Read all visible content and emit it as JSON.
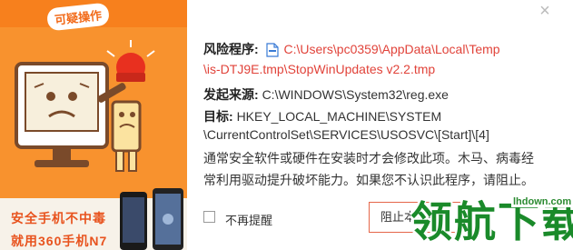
{
  "ad": {
    "badge": "可疑操作",
    "line1": "安全手机不中毒",
    "line2": "就用360手机N7"
  },
  "dialog": {
    "close_label": "×",
    "risk_label": "风险程序:",
    "risk_path_line1": "C:\\Users\\pc0359\\AppData\\Local\\Temp",
    "risk_path_line2": "\\is-DTJ9E.tmp\\StopWinUpdates v2.2.tmp",
    "source_label": "发起来源:",
    "source_value": "C:\\WINDOWS\\System32\\reg.exe",
    "target_label": "目标:",
    "target_line1": "HKEY_LOCAL_MACHINE\\SYSTEM",
    "target_line2": "\\CurrentControlSet\\SERVICES\\USOSVC\\[Start]\\[4]",
    "desc_line1": "通常安全软件或硬件在安装时才会修改此项。木马、病毒经",
    "desc_line2": "常利用驱动提升破坏能力。如果您不认识此程序，请阻止。",
    "no_remind_label": "不再提醒",
    "block_button_label": "阻止本次操作"
  },
  "watermark": {
    "text": "领航下载",
    "site": "lhdown.com"
  },
  "colors": {
    "accent": "#f8922e",
    "risk_red": "#e1433a",
    "watermark_green": "#1a8a2a"
  }
}
